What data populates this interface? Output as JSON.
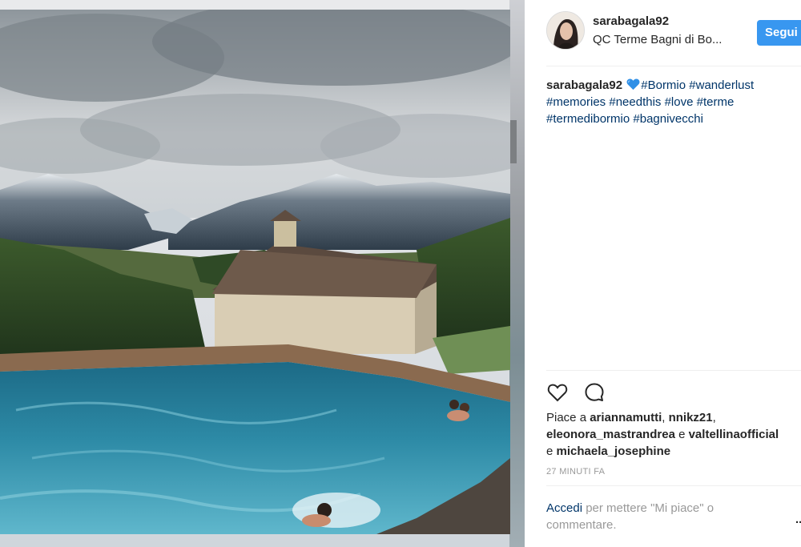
{
  "post": {
    "username": "sarabagala92",
    "location": "QC Terme Bagni di Bo...",
    "follow_label": "Segui"
  },
  "caption": {
    "username": "sarabagala92",
    "emoji": "blue-heart",
    "hashtags_line1": [
      "#Bormio",
      "#wanderlust"
    ],
    "hashtags_line2": [
      "#memories",
      "#needthis",
      "#love",
      "#terme"
    ],
    "hashtags_line3": [
      "#termedibormio",
      "#bagnivecchi"
    ]
  },
  "actions": {
    "like_icon": "heart-outline-icon",
    "comment_icon": "comment-bubble-icon"
  },
  "likes": {
    "prefix": "Piace a",
    "users": [
      "ariannamutti",
      "nnikz21",
      "eleonora_mastrandrea",
      "valtellinaofficial",
      "michaela_josephine"
    ],
    "sep_comma": ", ",
    "sep_and": " e "
  },
  "timestamp": "27 MINUTI FA",
  "login_prompt": {
    "link": "Accedi",
    "text": "per mettere \"Mi piace\" o commentare."
  },
  "more": "...",
  "colors": {
    "accent": "#3897f0",
    "link": "#003569",
    "muted": "#999999"
  }
}
